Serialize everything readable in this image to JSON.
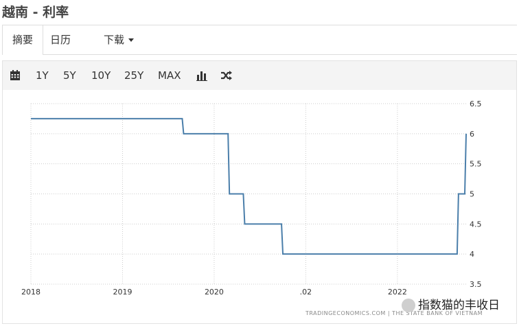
{
  "header": {
    "title": "越南 - 利率"
  },
  "tabs": [
    {
      "label": "摘要"
    },
    {
      "label": "日历"
    },
    {
      "label": "下载"
    }
  ],
  "toolbar": {
    "ranges": [
      "1Y",
      "5Y",
      "10Y",
      "25Y",
      "MAX"
    ],
    "icons": [
      "calendar-icon",
      "bar-chart-icon",
      "shuffle-icon"
    ]
  },
  "source_text": "TRADINGECONOMICS.COM | THE STATE BANK OF VIETNAM",
  "watermark_text": "指数猫的丰收日",
  "colors": {
    "line": "#4a7eaa",
    "grid": "#cccccc",
    "toolbar_bg": "#f4f4f4"
  },
  "chart_data": {
    "type": "line",
    "title": "",
    "xlabel": "",
    "ylabel": "",
    "x_tick_labels": [
      "2018",
      "2019",
      "2020",
      ".02",
      "2022"
    ],
    "y_tick_labels": [
      "6.5",
      "6",
      "5.5",
      "5",
      "4.5",
      "4",
      "3.5"
    ],
    "ylim": [
      3.5,
      6.5
    ],
    "xlim": [
      "2018-01",
      "2022-10"
    ],
    "series": [
      {
        "step": true,
        "points": [
          [
            "2018-01",
            6.25
          ],
          [
            "2019-09",
            6.0
          ],
          [
            "2020-03",
            5.0
          ],
          [
            "2020-05",
            4.5
          ],
          [
            "2020-10",
            4.0
          ],
          [
            "2022-09",
            5.0
          ],
          [
            "2022-10",
            6.0
          ]
        ]
      }
    ]
  }
}
